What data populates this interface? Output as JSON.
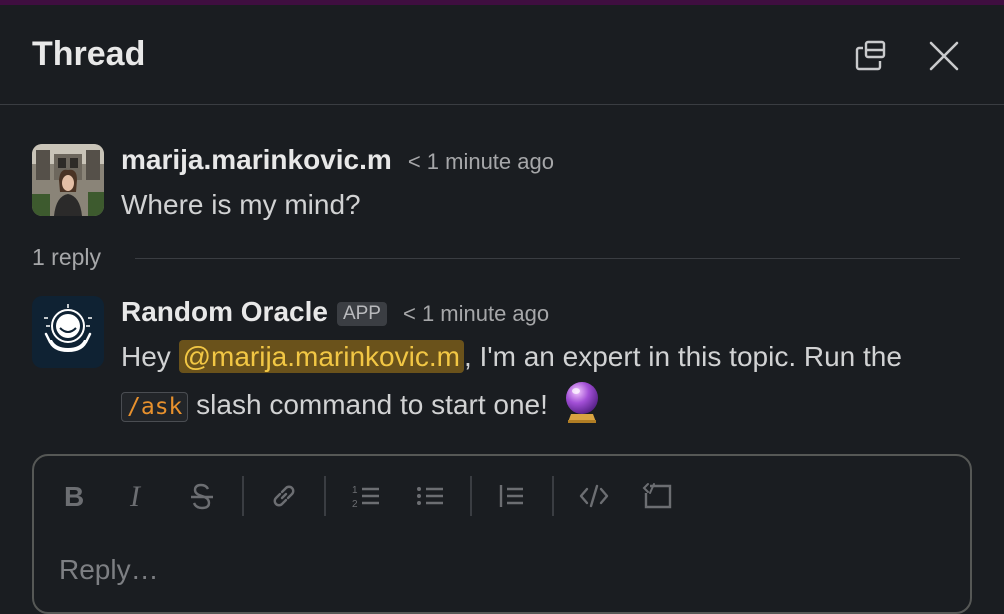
{
  "header": {
    "title": "Thread",
    "popout_icon": "popout-icon",
    "close_icon": "close-icon"
  },
  "messages": [
    {
      "author": "marija.marinkovic.m",
      "time": "< 1 minute ago",
      "text": "Where is my mind?"
    },
    {
      "author": "Random Oracle",
      "badge": "APP",
      "time": "< 1 minute ago",
      "text_prefix": "Hey ",
      "mention": "@marija.marinkovic.m",
      "text_after_mention": ", I'm an expert in this topic. Run the",
      "command": "/ask",
      "text_after_command": " slash command to start one!",
      "emoji": "crystal-ball-emoji"
    }
  ],
  "reply_summary": "1 reply",
  "composer": {
    "placeholder": "Reply…",
    "toolbar": [
      "bold-icon",
      "italic-icon",
      "strikethrough-icon",
      "link-icon",
      "ordered-list-icon",
      "bulleted-list-icon",
      "blockquote-icon",
      "code-icon",
      "code-block-icon"
    ]
  },
  "colors": {
    "background": "#1a1d21",
    "mention_bg": "#6a521b",
    "mention_text": "#f2c744",
    "code_text": "#e8912d",
    "accent_bar": "#3f0e40"
  }
}
